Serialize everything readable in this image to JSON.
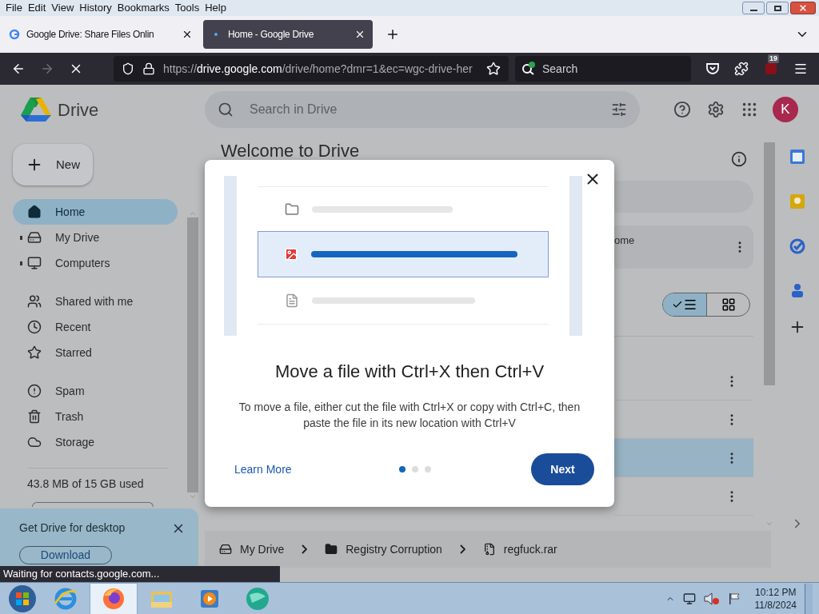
{
  "menu_bar": [
    "File",
    "Edit",
    "View",
    "History",
    "Bookmarks",
    "Tools",
    "Help"
  ],
  "tabs": [
    {
      "title": "Google Drive: Share Files Onlin",
      "selected": false,
      "loading": false
    },
    {
      "title": "Home - Google Drive",
      "selected": true,
      "loading": true
    }
  ],
  "toolbar": {
    "forward_disabled": true,
    "loading": true,
    "url": {
      "scheme": "https://",
      "domain": "drive.google.com",
      "path": "/drive/home?dmr=1&ec=wgc-drive-her"
    },
    "search_placeholder": "Search",
    "extension_badge": "19"
  },
  "drive": {
    "logo_text": "Drive",
    "search_placeholder": "Search in Drive",
    "avatar": "K",
    "new_button": "New",
    "nav_groups": [
      [
        {
          "label": "Home",
          "kind": "home",
          "selected": true,
          "expandable": false
        },
        {
          "label": "My Drive",
          "kind": "drive",
          "selected": false,
          "expandable": true
        },
        {
          "label": "Computers",
          "kind": "computers",
          "selected": false,
          "expandable": true
        }
      ],
      [
        {
          "label": "Shared with me",
          "kind": "shared",
          "selected": false,
          "expandable": false
        },
        {
          "label": "Recent",
          "kind": "recent",
          "selected": false,
          "expandable": false
        },
        {
          "label": "Starred",
          "kind": "starred",
          "selected": false,
          "expandable": false
        }
      ],
      [
        {
          "label": "Spam",
          "kind": "spam",
          "selected": false,
          "expandable": false
        },
        {
          "label": "Trash",
          "kind": "trash",
          "selected": false,
          "expandable": false
        },
        {
          "label": "Storage",
          "kind": "storage",
          "selected": false,
          "expandable": false
        }
      ]
    ],
    "storage_text": "43.8 MB of 15 GB used",
    "desktop_promo": {
      "title": "Get Drive for desktop",
      "button": "Download"
    },
    "page_title": "Welcome to Drive",
    "suggested_card_text": "ome",
    "view_toggle": [
      {
        "kind": "list",
        "selected": true
      },
      {
        "kind": "grid",
        "selected": false
      }
    ],
    "file_rows": [
      {
        "selected": false
      },
      {
        "selected": false
      },
      {
        "selected": true
      },
      {
        "selected": false
      }
    ],
    "breadcrumb": [
      {
        "label": "My Drive",
        "kind": "drive"
      },
      {
        "label": "Registry Corruption",
        "kind": "folder"
      },
      {
        "label": "regfuck.rar",
        "kind": "archive"
      }
    ]
  },
  "dialog": {
    "title": "Move a file with Ctrl+X then Ctrl+V",
    "body": "To move a file, either cut the file with Ctrl+X or copy with Ctrl+C, then paste the file in its new location with Ctrl+V",
    "link": "Learn More",
    "button": "Next",
    "pages": [
      {
        "selected": true
      },
      {
        "selected": false
      },
      {
        "selected": false
      }
    ]
  },
  "status_text": "Waiting for contacts.google.com...",
  "taskbar": {
    "apps": [
      {
        "kind": "ie",
        "active": false
      },
      {
        "kind": "firefox",
        "active": true
      },
      {
        "kind": "explorer",
        "active": false
      },
      {
        "kind": "media",
        "active": false
      },
      {
        "kind": "globe",
        "active": false
      }
    ],
    "time": "10:12 PM",
    "date": "11/8/2024",
    "volume_muted": true
  }
}
